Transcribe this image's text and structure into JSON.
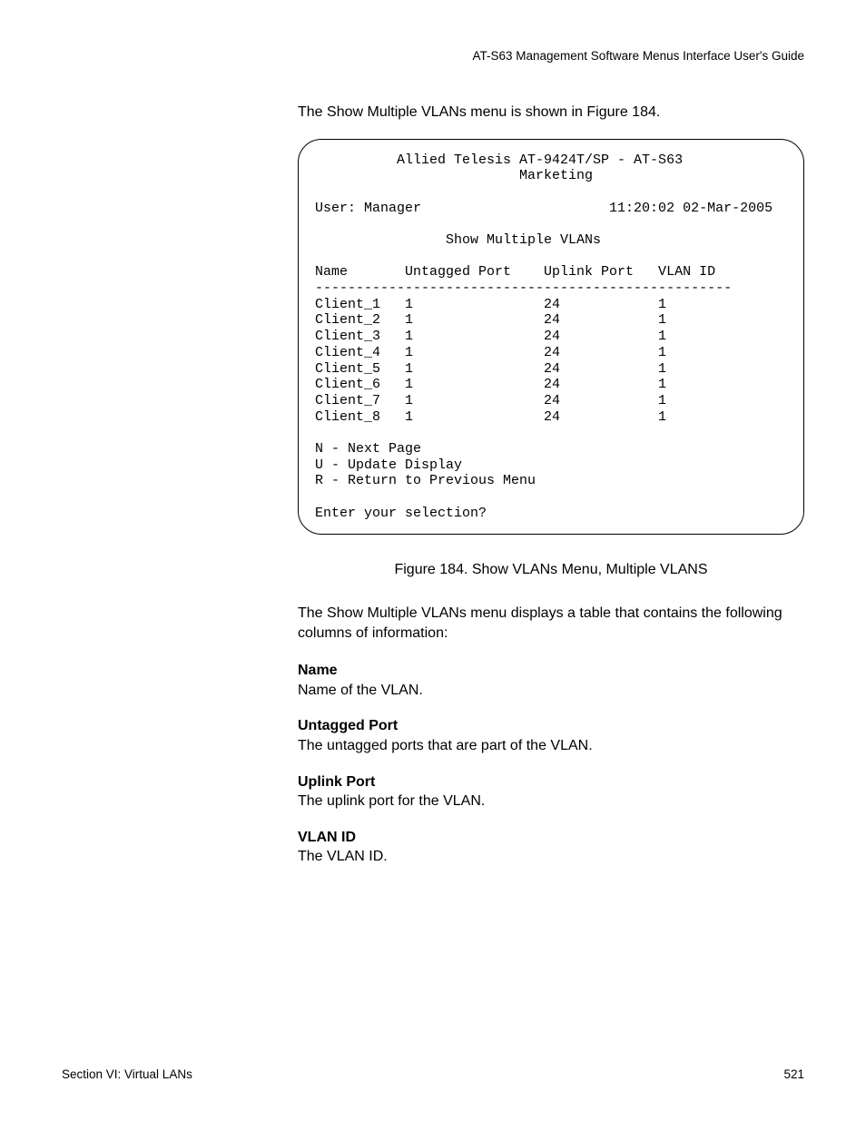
{
  "header": {
    "guide_title": "AT-S63 Management Software Menus Interface User's Guide"
  },
  "intro": "The Show Multiple VLANs menu is shown in Figure 184.",
  "terminal": {
    "title1": "Allied Telesis AT-9424T/SP - AT-S63",
    "title2": "Marketing",
    "user_label": "User: Manager",
    "timestamp": "11:20:02 02-Mar-2005",
    "menu_title": "Show Multiple VLANs",
    "columns": {
      "c1": "Name",
      "c2": "Untagged Port",
      "c3": "Uplink Port",
      "c4": "VLAN ID"
    },
    "separator": "---------------------------------------------------",
    "rows": [
      {
        "name": "Client_1",
        "untagged": "1",
        "uplink": "24",
        "vlan": "1"
      },
      {
        "name": "Client_2",
        "untagged": "1",
        "uplink": "24",
        "vlan": "1"
      },
      {
        "name": "Client_3",
        "untagged": "1",
        "uplink": "24",
        "vlan": "1"
      },
      {
        "name": "Client_4",
        "untagged": "1",
        "uplink": "24",
        "vlan": "1"
      },
      {
        "name": "Client_5",
        "untagged": "1",
        "uplink": "24",
        "vlan": "1"
      },
      {
        "name": "Client_6",
        "untagged": "1",
        "uplink": "24",
        "vlan": "1"
      },
      {
        "name": "Client_7",
        "untagged": "1",
        "uplink": "24",
        "vlan": "1"
      },
      {
        "name": "Client_8",
        "untagged": "1",
        "uplink": "24",
        "vlan": "1"
      }
    ],
    "opts": {
      "n": "N - Next Page",
      "u": "U - Update Display",
      "r": "R - Return to Previous Menu"
    },
    "prompt": "Enter your selection?"
  },
  "caption": "Figure 184. Show VLANs Menu, Multiple VLANS",
  "desc_intro": "The Show Multiple VLANs menu displays a table that contains the following columns of information:",
  "defs": {
    "name": {
      "term": "Name",
      "text": "Name of the VLAN."
    },
    "untagged": {
      "term": "Untagged Port",
      "text": "The untagged ports that are part of the VLAN."
    },
    "uplink": {
      "term": "Uplink Port",
      "text": "The uplink port for the VLAN."
    },
    "vlanid": {
      "term": "VLAN ID",
      "text": "The VLAN ID."
    }
  },
  "footer": {
    "left": "Section VI: Virtual LANs",
    "right": "521"
  }
}
